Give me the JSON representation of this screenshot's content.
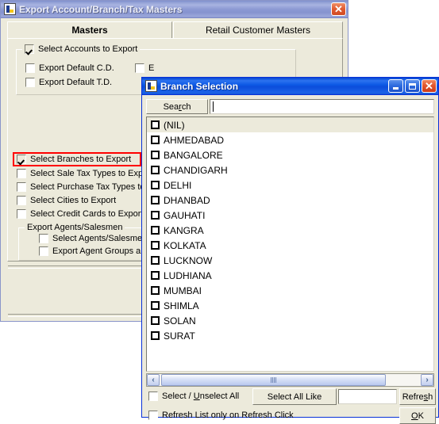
{
  "main_window": {
    "title": "Export Account/Branch/Tax Masters",
    "icon": "app-logo-icon",
    "close_label": "✕",
    "tabs": [
      {
        "label": "Masters",
        "selected": true
      },
      {
        "label": "Retail Customer Masters",
        "selected": false
      }
    ],
    "accounts_group": {
      "title": "Select Accounts to Export",
      "checked": true,
      "items": [
        {
          "label": "Export Default C.D.",
          "checked": false
        },
        {
          "label": "Export Default T.D.",
          "checked": false
        },
        {
          "label": "E",
          "checked": false,
          "occluded": true
        }
      ]
    },
    "selection_checkboxes": [
      {
        "label": "Select Branches to Export",
        "checked": true,
        "highlighted": true
      },
      {
        "label": "Select Sale Tax Types to Export",
        "checked": false,
        "highlighted": false
      },
      {
        "label": "Select Purchase Tax Types to Export",
        "checked": false,
        "highlighted": false
      },
      {
        "label": "Select Cities to Export",
        "checked": false,
        "highlighted": false
      },
      {
        "label": "Select Credit Cards to Export",
        "checked": false,
        "highlighted": false
      }
    ],
    "agents_group": {
      "title": "Export Agents/Salesmen",
      "items": [
        {
          "label": "Select Agents/Salesmen to Export",
          "checked": false
        },
        {
          "label": "Export Agent Groups also",
          "checked": false
        }
      ]
    }
  },
  "branch_window": {
    "title": "Branch Selection",
    "icon": "app-logo-icon",
    "minimize_label": "",
    "maximize_label": "",
    "close_label": "✕",
    "search": {
      "button_label_a": "Sea",
      "button_label_accel": "r",
      "button_label_b": "ch",
      "input_value": "",
      "placeholder": ""
    },
    "list": [
      {
        "label": "(NIL)",
        "checked": false,
        "selected": true
      },
      {
        "label": "AHMEDABAD",
        "checked": false,
        "selected": false
      },
      {
        "label": "BANGALORE",
        "checked": false,
        "selected": false
      },
      {
        "label": "CHANDIGARH",
        "checked": false,
        "selected": false
      },
      {
        "label": "DELHI",
        "checked": false,
        "selected": false
      },
      {
        "label": "DHANBAD",
        "checked": false,
        "selected": false
      },
      {
        "label": "GAUHATI",
        "checked": false,
        "selected": false
      },
      {
        "label": "KANGRA",
        "checked": false,
        "selected": false
      },
      {
        "label": "KOLKATA",
        "checked": false,
        "selected": false
      },
      {
        "label": "LUCKNOW",
        "checked": false,
        "selected": false
      },
      {
        "label": "LUDHIANA",
        "checked": false,
        "selected": false
      },
      {
        "label": "MUMBAI",
        "checked": false,
        "selected": false
      },
      {
        "label": "SHIMLA",
        "checked": false,
        "selected": false
      },
      {
        "label": "SOLAN",
        "checked": false,
        "selected": false
      },
      {
        "label": "SURAT",
        "checked": false,
        "selected": false
      }
    ],
    "scrollbar": {
      "left_arrow": "‹",
      "right_arrow": "›"
    },
    "footer": {
      "select_unselect_a": "Select / ",
      "select_unselect_accel": "U",
      "select_unselect_b": "nselect All",
      "select_unselect_checked": false,
      "select_all_like_label": "Select All Like",
      "like_value": "",
      "refresh_a": "Refre",
      "refresh_accel": "s",
      "refresh_b": "h",
      "refresh_only_label": "Refresh List only on Refresh Click",
      "refresh_only_checked": false,
      "ok_accel": "O",
      "ok_b": "K"
    }
  },
  "colors": {
    "active_title": "#0b4ddb",
    "inactive_title": "#8d9ad4",
    "face": "#eceadb",
    "highlight_border": "#ff0000",
    "window_border": "#0831d9"
  }
}
